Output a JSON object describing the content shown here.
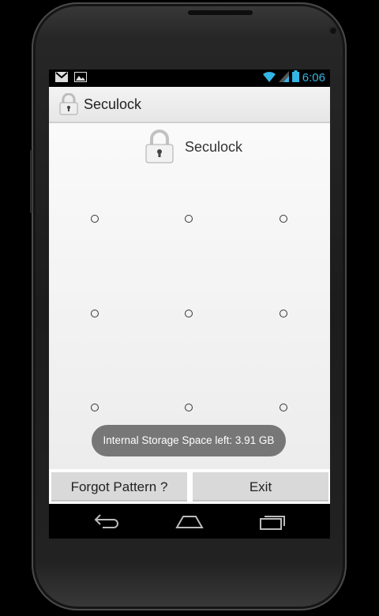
{
  "status_bar": {
    "time": "6:06",
    "left_icons": [
      "gmail-icon",
      "gallery-icon"
    ],
    "right_icons": [
      "wifi-icon",
      "signal-icon",
      "battery-icon"
    ]
  },
  "action_bar": {
    "title": "Seculock",
    "icon": "padlock-icon"
  },
  "header": {
    "title": "Seculock",
    "icon": "padlock-icon"
  },
  "pattern_grid": {
    "rows": 3,
    "cols": 3
  },
  "toast": {
    "text": "Internal Storage Space left: 3.91 GB"
  },
  "buttons": {
    "forgot": "Forgot Pattern ?",
    "exit": "Exit"
  },
  "nav_bar": {
    "items": [
      "back-icon",
      "home-icon",
      "recents-icon"
    ]
  },
  "colors": {
    "accent": "#33b5e5",
    "toast_bg": "#777777",
    "button_bg": "#d9d9d9"
  }
}
